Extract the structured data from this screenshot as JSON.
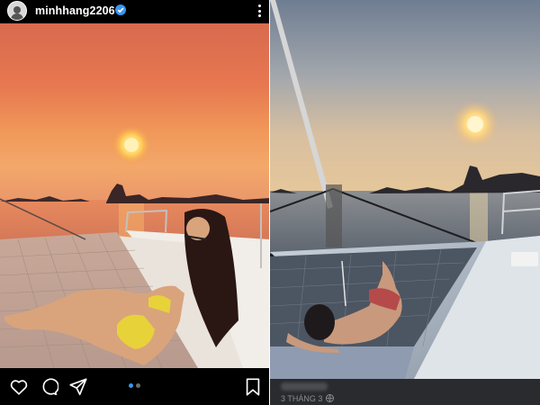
{
  "instagram": {
    "username": "minhhang2206",
    "verified": true,
    "carousel": {
      "current": 1,
      "total": 2
    },
    "actions": [
      "heart-icon",
      "comment-icon",
      "share-icon",
      "bookmark-icon"
    ],
    "colors": {
      "accent": "#3897f0",
      "background": "#000000"
    }
  },
  "facebook": {
    "post_date": "3 THÁNG 3",
    "privacy": "globe-icon"
  }
}
